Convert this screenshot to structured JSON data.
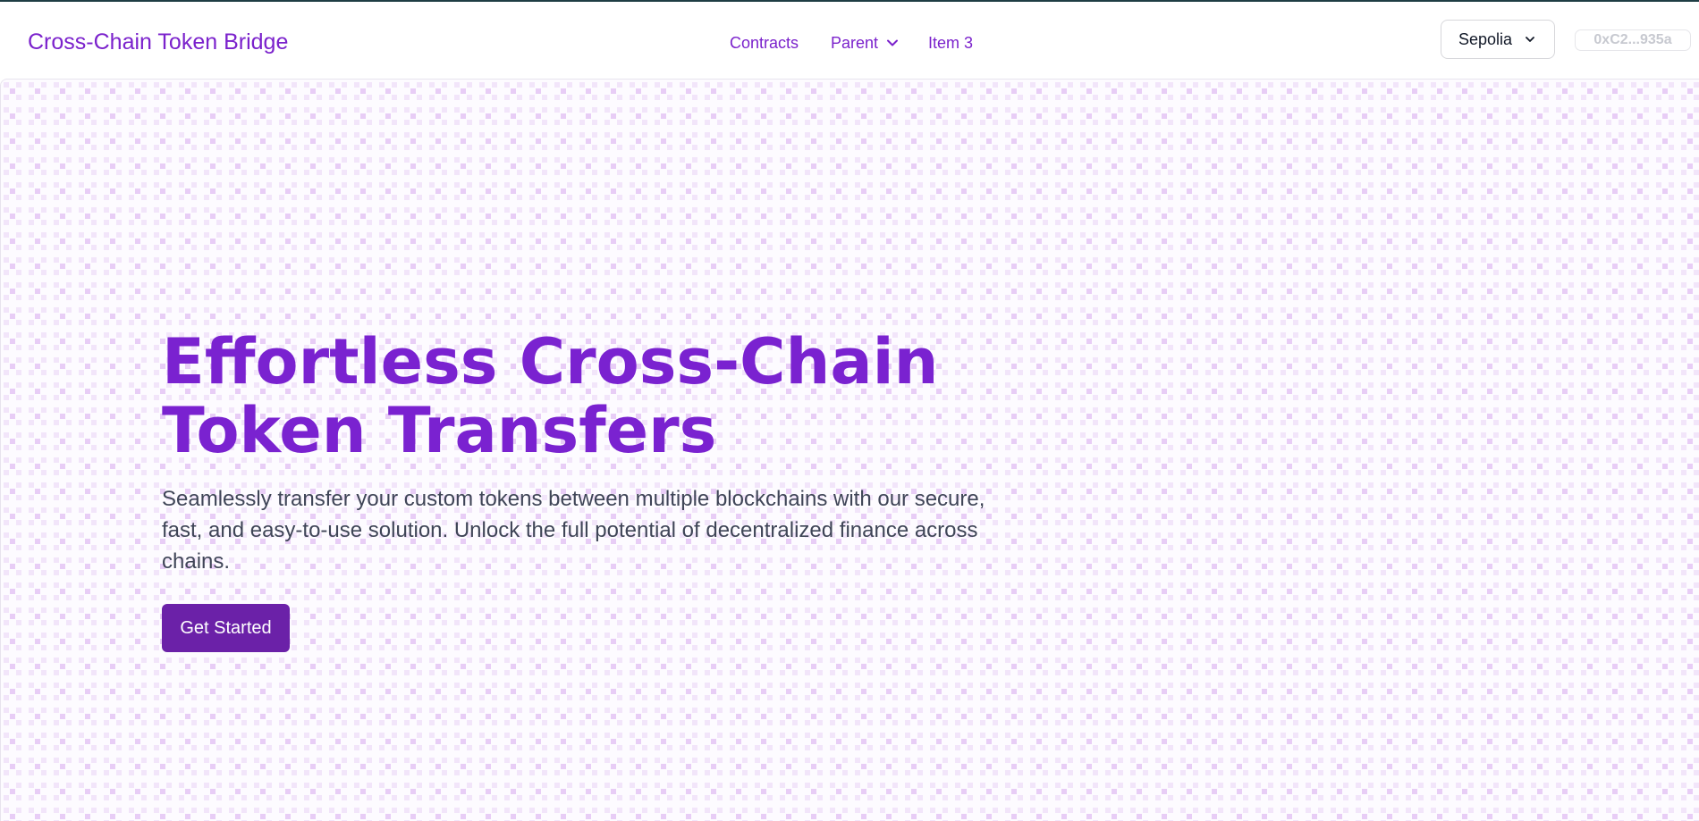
{
  "header": {
    "brand": "Cross-Chain Token Bridge",
    "nav": [
      {
        "label": "Contracts"
      },
      {
        "label": "Parent"
      },
      {
        "label": "Item 3"
      }
    ],
    "network": "Sepolia",
    "wallet": "0xC2...935a"
  },
  "hero": {
    "title_line1": "Effortless Cross-Chain",
    "title_line2": "Token Transfers",
    "subtitle": "Seamlessly transfer your custom tokens between multiple blockchains with our secure, fast, and easy-to-use solution. Unlock the full potential of decentralized finance across chains.",
    "cta": "Get Started"
  },
  "colors": {
    "accent": "#7b22cc",
    "button": "#6b21a8",
    "background_dots": "#e6c9f4"
  }
}
